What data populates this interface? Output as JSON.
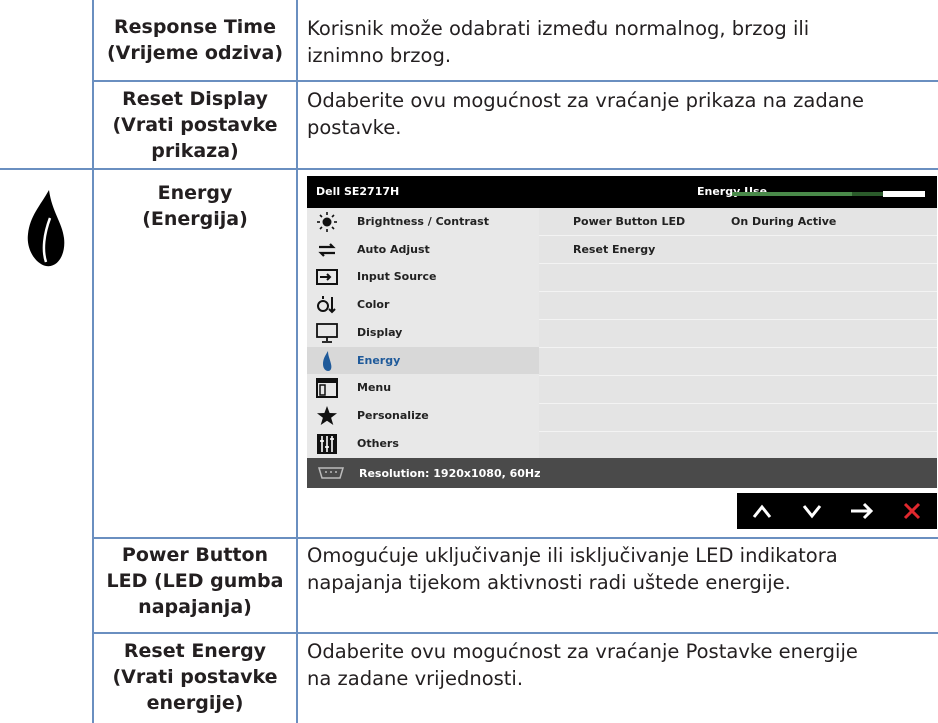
{
  "rows": {
    "response_time": {
      "label_l1": "Response Time",
      "label_l2": "(Vrijeme odziva)",
      "desc_l1": "Korisnik može odabrati između normalnog, brzog ili",
      "desc_l2": "iznimno brzog."
    },
    "reset_display": {
      "label_l1": "Reset Display",
      "label_l2": "(Vrati postavke",
      "label_l3": "prikaza)",
      "desc_l1": "Odaberite ovu mogućnost za vraćanje prikaza na zadane",
      "desc_l2": "postavke."
    },
    "energy": {
      "label_l1": "Energy",
      "label_l2": "(Energija)",
      "icon": "energy-leaf-icon"
    },
    "power_button_led": {
      "label_l1": "Power Button",
      "label_l2": "LED (LED gumba",
      "label_l3": "napajanja)",
      "desc_l1": "Omogućuje uključivanje ili isključivanje LED indikatora",
      "desc_l2": "napajanja tijekom aktivnosti radi uštede energije."
    },
    "reset_energy": {
      "label_l1": "Reset Energy",
      "label_l2": "(Vrati postavke",
      "label_l3": "energije)",
      "desc_l1": "Odaberite ovu mogućnost za vraćanje Postavke energije",
      "desc_l2": "na zadane vrijednosti."
    }
  },
  "osd": {
    "model": "Dell SE2717H",
    "energy_use_label": "Energy Use",
    "energy_use_level": 0.62,
    "menu": [
      {
        "label": "Brightness / Contrast",
        "icon": "brightness-icon"
      },
      {
        "label": "Auto Adjust",
        "icon": "auto-adjust-icon"
      },
      {
        "label": "Input Source",
        "icon": "input-source-icon"
      },
      {
        "label": "Color",
        "icon": "color-icon"
      },
      {
        "label": "Display",
        "icon": "display-icon"
      },
      {
        "label": "Energy",
        "icon": "energy-icon"
      },
      {
        "label": "Menu",
        "icon": "menu-icon"
      },
      {
        "label": "Personalize",
        "icon": "star-icon"
      },
      {
        "label": "Others",
        "icon": "others-icon"
      }
    ],
    "selected": "Energy",
    "options": [
      {
        "name": "Power Button LED",
        "value": "On During Active"
      },
      {
        "name": "Reset Energy",
        "value": ""
      }
    ],
    "resolution": "Resolution: 1920x1080, 60Hz",
    "nav": [
      "up-arrow-icon",
      "down-arrow-icon",
      "right-arrow-icon",
      "close-icon"
    ],
    "colors": {
      "close": "#e0282e",
      "accent": "#1f5a9a",
      "bar": "#4a8a4a"
    }
  }
}
